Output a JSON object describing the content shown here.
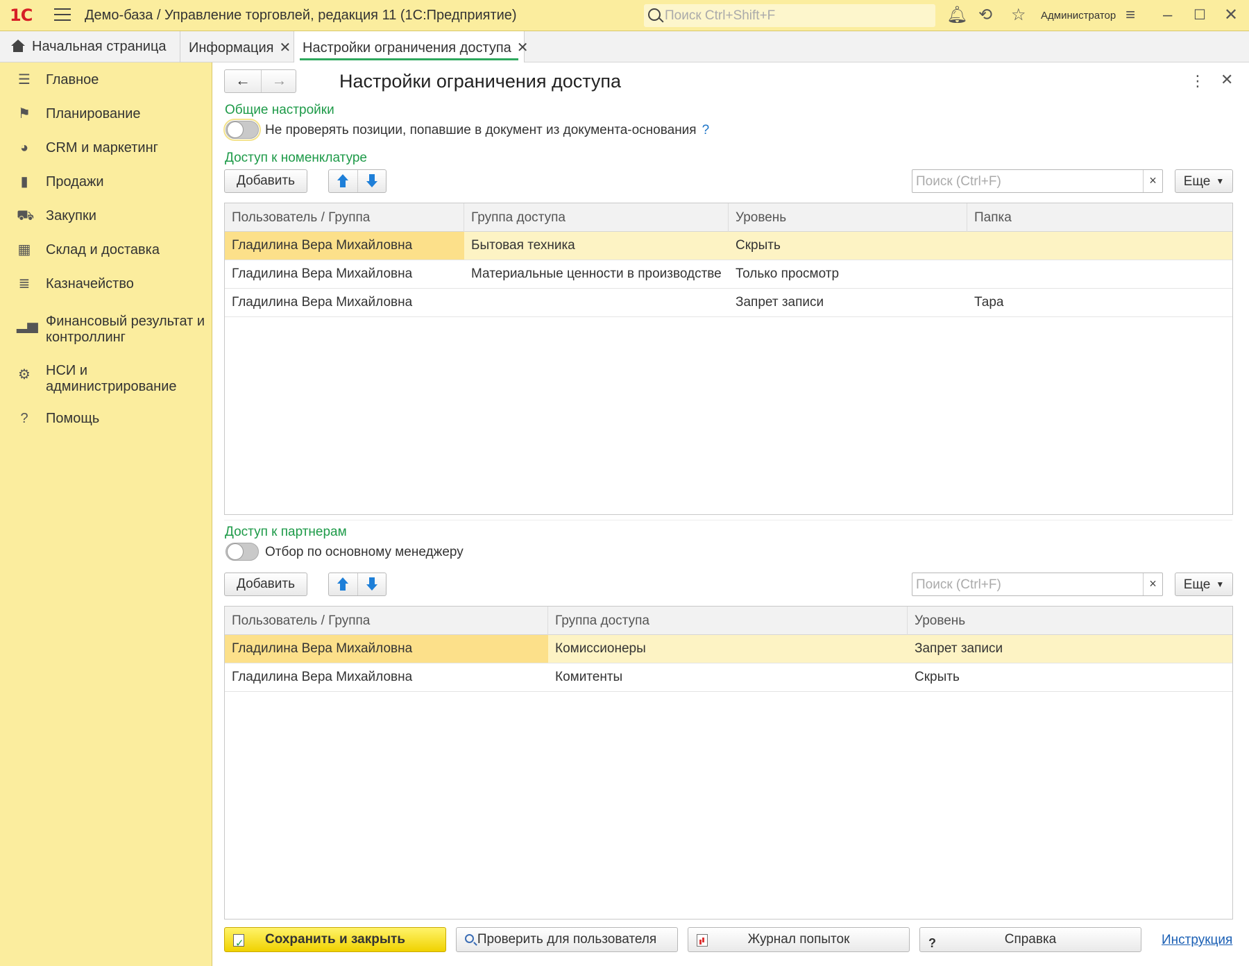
{
  "titlebar": {
    "logo": "1С",
    "title": "Демо-база / Управление торговлей, редакция 11  (1С:Предприятие)",
    "search_placeholder": "Поиск Ctrl+Shift+F",
    "user": "Администратор",
    "icons": [
      "bell-icon",
      "history-icon",
      "star-icon",
      "settings-lines-icon",
      "minimize-icon",
      "maximize-icon",
      "close-icon"
    ]
  },
  "tabs": [
    {
      "label": "Начальная страница",
      "icon": "home-icon"
    },
    {
      "label": "Информация",
      "close": "✕"
    },
    {
      "label": "Настройки ограничения доступа",
      "close": "✕",
      "active": true
    }
  ],
  "sidebar": {
    "items": [
      {
        "label": "Главное",
        "icon": "list-icon"
      },
      {
        "label": "Планирование",
        "icon": "planning-icon"
      },
      {
        "label": "CRM и маркетинг",
        "icon": "pie-icon"
      },
      {
        "label": "Продажи",
        "icon": "bag-icon"
      },
      {
        "label": "Закупки",
        "icon": "cart-icon"
      },
      {
        "label": "Склад и доставка",
        "icon": "warehouse-icon"
      },
      {
        "label": "Казначейство",
        "icon": "coins-icon"
      },
      {
        "label": "Финансовый результат и",
        "label2": "контроллинг",
        "icon": "bar-chart-icon"
      },
      {
        "label": "НСИ и",
        "label2": "администрирование",
        "icon": "gear-icon"
      },
      {
        "label": "Помощь",
        "icon": "help-icon"
      }
    ]
  },
  "form": {
    "title": "Настройки ограничения доступа",
    "general": {
      "header": "Общие настройки",
      "toggle_label": "Не проверять позиции, попавшие в документ из документа-основания",
      "help": "?"
    },
    "nomenclature": {
      "header": "Доступ к номенклатуре",
      "add": "Добавить",
      "search_placeholder": "Поиск (Ctrl+F)",
      "clear": "×",
      "more": "Еще",
      "columns": [
        "Пользователь / Группа",
        "Группа доступа",
        "Уровень",
        "Папка"
      ],
      "rows": [
        [
          "Гладилина Вера Михайловна",
          "Бытовая техника",
          "Скрыть",
          ""
        ],
        [
          "Гладилина Вера Михайловна",
          "Материальные ценности в производстве",
          "Только просмотр",
          ""
        ],
        [
          "Гладилина Вера Михайловна",
          "",
          "Запрет записи",
          "Тара"
        ]
      ]
    },
    "partners": {
      "header": "Доступ к партнерам",
      "toggle_label": "Отбор по основному менеджеру",
      "add": "Добавить",
      "search_placeholder": "Поиск (Ctrl+F)",
      "clear": "×",
      "more": "Еще",
      "columns": [
        "Пользователь / Группа",
        "Группа доступа",
        "Уровень"
      ],
      "rows": [
        [
          "Гладилина Вера Михайловна",
          "Комиссионеры",
          "Запрет записи"
        ],
        [
          "Гладилина Вера Михайловна",
          "Комитенты",
          "Скрыть"
        ]
      ]
    },
    "footer": {
      "save": "Сохранить и закрыть",
      "check": "Проверить для пользователя",
      "log": "Журнал попыток",
      "help_q": "?",
      "help": "Справка",
      "link": "Инструкция"
    }
  }
}
